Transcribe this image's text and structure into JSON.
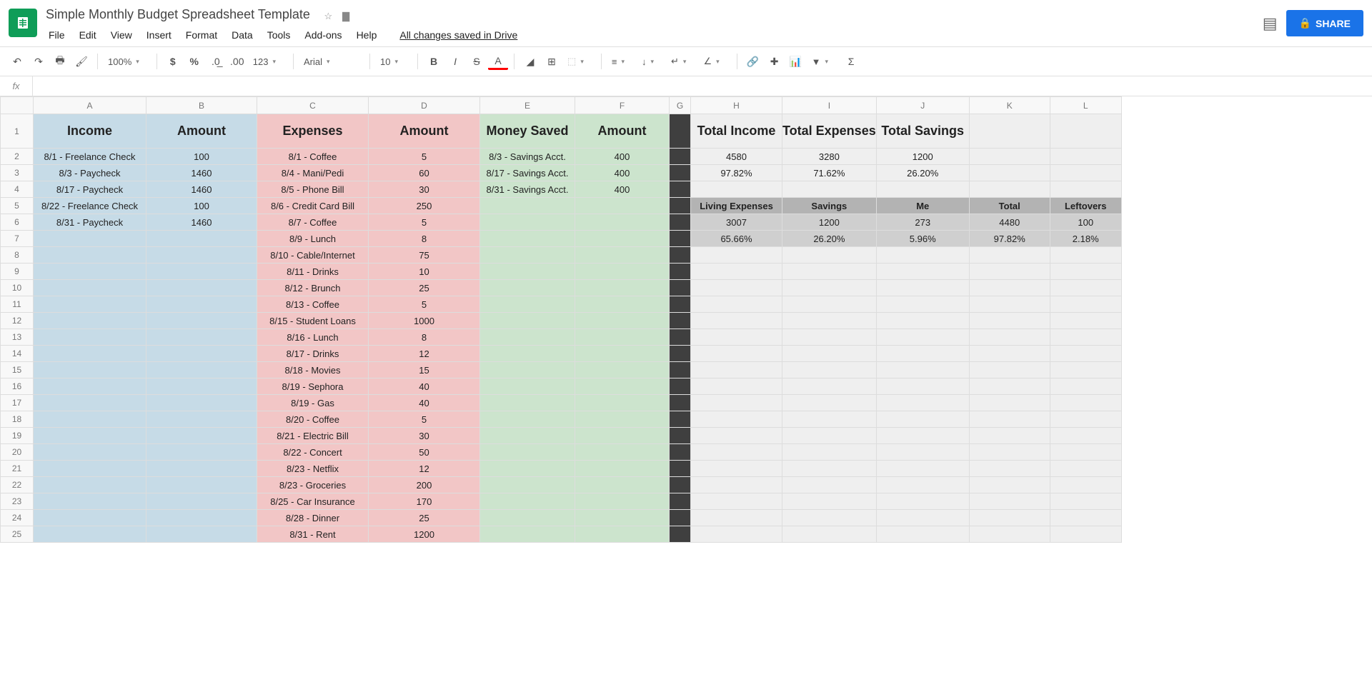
{
  "doc": {
    "title": "Simple Monthly Budget Spreadsheet Template",
    "save_status": "All changes saved in Drive"
  },
  "menu": [
    "File",
    "Edit",
    "View",
    "Insert",
    "Format",
    "Data",
    "Tools",
    "Add-ons",
    "Help"
  ],
  "share": "SHARE",
  "tb": {
    "zoom": "100%",
    "font": "Arial",
    "size": "10"
  },
  "cols": [
    "A",
    "B",
    "C",
    "D",
    "E",
    "F",
    "G",
    "H",
    "I",
    "J",
    "K",
    "L"
  ],
  "headers1": {
    "A": "Income",
    "B": "Amount",
    "C": "Expenses",
    "D": "Amount",
    "E": "Money Saved",
    "F": "Amount",
    "H": "Total Income",
    "I": "Total Expenses",
    "J": "Total Savings"
  },
  "rows": [
    {
      "A": "8/1 - Freelance Check",
      "B": "100",
      "C": "8/1 - Coffee",
      "D": "5",
      "E": "8/3 - Savings Acct.",
      "F": "400",
      "H": "4580",
      "I": "3280",
      "J": "1200"
    },
    {
      "A": "8/3 - Paycheck",
      "B": "1460",
      "C": "8/4 - Mani/Pedi",
      "D": "60",
      "E": "8/17 - Savings Acct.",
      "F": "400",
      "H": "97.82%",
      "I": "71.62%",
      "J": "26.20%"
    },
    {
      "A": "8/17 - Paycheck",
      "B": "1460",
      "C": "8/5 - Phone Bill",
      "D": "30",
      "E": "8/31 - Savings Acct.",
      "F": "400"
    },
    {
      "A": "8/22 - Freelance Check",
      "B": "100",
      "C": "8/6 - Credit Card Bill",
      "D": "250",
      "H": "Living Expenses",
      "I": "Savings",
      "J": "Me",
      "K": "Total",
      "L": "Leftovers",
      "hdr2": true
    },
    {
      "A": "8/31 - Paycheck",
      "B": "1460",
      "C": "8/7 - Coffee",
      "D": "5",
      "H": "3007",
      "I": "1200",
      "J": "273",
      "K": "4480",
      "L": "100",
      "mgrey": true
    },
    {
      "C": "8/9 - Lunch",
      "D": "8",
      "H": "65.66%",
      "I": "26.20%",
      "J": "5.96%",
      "K": "97.82%",
      "L": "2.18%",
      "mgrey": true
    },
    {
      "C": "8/10 - Cable/Internet",
      "D": "75"
    },
    {
      "C": "8/11 - Drinks",
      "D": "10"
    },
    {
      "C": "8/12 - Brunch",
      "D": "25"
    },
    {
      "C": "8/13 - Coffee",
      "D": "5"
    },
    {
      "C": "8/15 - Student Loans",
      "D": "1000"
    },
    {
      "C": "8/16 - Lunch",
      "D": "8"
    },
    {
      "C": "8/17 - Drinks",
      "D": "12"
    },
    {
      "C": "8/18 - Movies",
      "D": "15"
    },
    {
      "C": "8/19 - Sephora",
      "D": "40"
    },
    {
      "C": "8/19 - Gas",
      "D": "40"
    },
    {
      "C": "8/20 - Coffee",
      "D": "5"
    },
    {
      "C": "8/21 - Electric Bill",
      "D": "30"
    },
    {
      "C": "8/22 - Concert",
      "D": "50"
    },
    {
      "C": "8/23 - Netflix",
      "D": "12"
    },
    {
      "C": "8/23 - Groceries",
      "D": "200"
    },
    {
      "C": "8/25 - Car Insurance",
      "D": "170"
    },
    {
      "C": "8/28 - Dinner",
      "D": "25"
    },
    {
      "C": "8/31 - Rent",
      "D": "1200"
    }
  ]
}
